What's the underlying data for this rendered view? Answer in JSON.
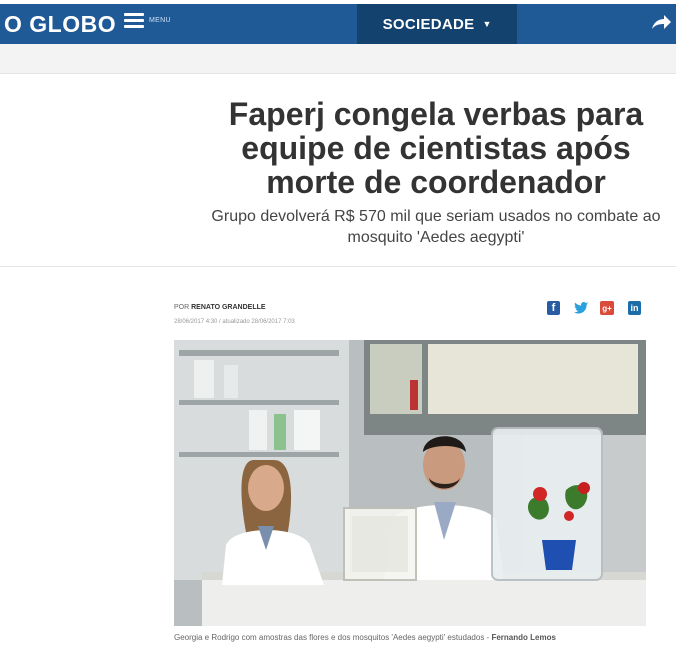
{
  "header": {
    "logo": "O GLOBO",
    "menu_label": "MENU",
    "section": "SOCIEDADE",
    "section_caret": "▼",
    "share_icon": "share-arrow-icon"
  },
  "article": {
    "headline": "Faperj congela verbas para equipe de cientistas após morte de coordenador",
    "subheadline": "Grupo devolverá R$ 570 mil que seriam usados no combate ao mosquito 'Aedes aegypti'",
    "byline_prefix": "POR",
    "author": "RENATO GRANDELLE",
    "dates": "28/06/2017 4:30 / atualizado 28/06/2017 7:03",
    "social": {
      "facebook": "f",
      "twitter": "🐦",
      "googleplus": "g+",
      "linkedin": "in"
    },
    "photo_caption": "Georgia e Rodrigo com amostras das flores e dos mosquitos 'Aedes aegypti' estudados - ",
    "photo_credit": "Fernando Lemos"
  },
  "colors": {
    "header_blue": "#1f5a97",
    "section_blue": "#13426f",
    "facebook": "#2a5ca3",
    "twitter": "#2aa1de",
    "googleplus": "#d94b3b",
    "linkedin": "#1d6ea8"
  }
}
